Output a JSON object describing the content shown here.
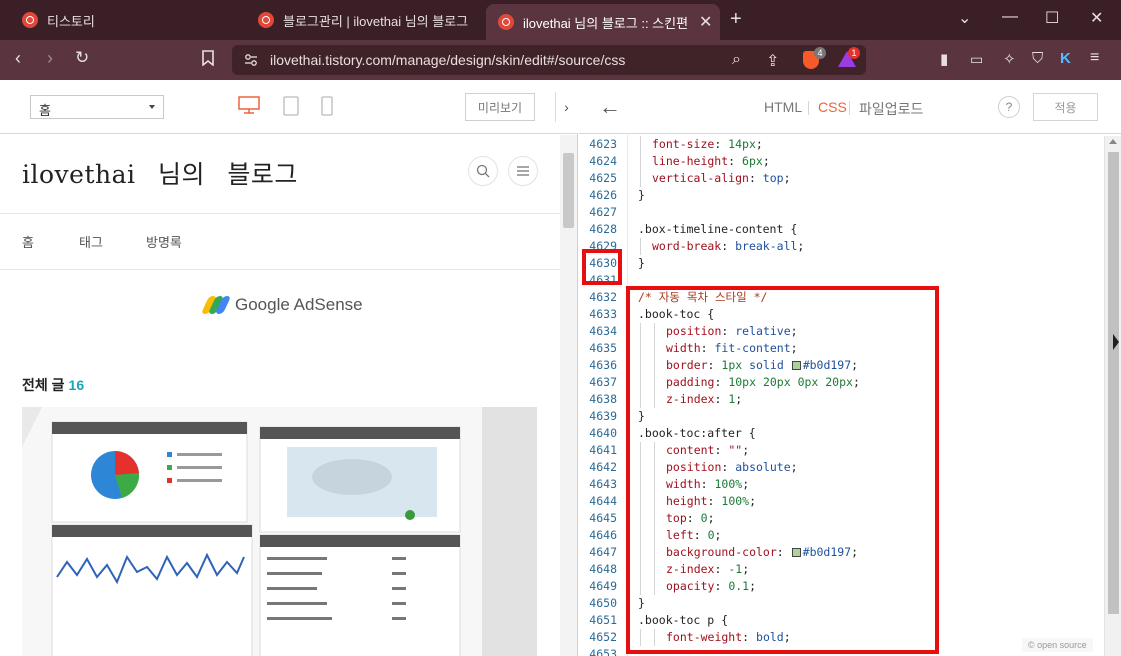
{
  "browser": {
    "tabs": [
      {
        "label": "티스토리",
        "active": false
      },
      {
        "label": "블로그관리 | ilovethai 님의 블로그",
        "active": false
      },
      {
        "label": "ilovethai 님의 블로그 :: 스킨편",
        "active": true
      }
    ],
    "url": "ilovethai.tistory.com/manage/design/skin/edit#/source/css",
    "badges": {
      "brave": "4",
      "rewards": "1"
    }
  },
  "preview": {
    "page_select": "홈",
    "preview_button": "미리보기",
    "blog_title": "ilovethai 님의 블로그",
    "menu": [
      "홈",
      "태그",
      "방명록"
    ],
    "adsense_text": "Google AdSense",
    "all_posts_label": "전체 글",
    "all_posts_count": "16"
  },
  "editor": {
    "tabs": [
      {
        "label": "HTML",
        "active": false
      },
      {
        "label": "CSS",
        "active": true
      },
      {
        "label": "파일업로드",
        "active": false
      }
    ],
    "help": "?",
    "apply_button": "적용",
    "open_source": "© open source"
  },
  "code_lines": [
    {
      "n": "4623",
      "indent": 1,
      "tokens": [
        [
          "prop",
          "font-size"
        ],
        [
          "pun",
          ": "
        ],
        [
          "num",
          "14px"
        ],
        [
          "pun",
          ";"
        ]
      ]
    },
    {
      "n": "4624",
      "indent": 1,
      "tokens": [
        [
          "prop",
          "line-height"
        ],
        [
          "pun",
          ": "
        ],
        [
          "num",
          "6px"
        ],
        [
          "pun",
          ";"
        ]
      ]
    },
    {
      "n": "4625",
      "indent": 1,
      "tokens": [
        [
          "prop",
          "vertical-align"
        ],
        [
          "pun",
          ": "
        ],
        [
          "val",
          "top"
        ],
        [
          "pun",
          ";"
        ]
      ]
    },
    {
      "n": "4626",
      "indent": 0,
      "tokens": [
        [
          "pun",
          "}"
        ]
      ]
    },
    {
      "n": "4627",
      "indent": 0,
      "tokens": []
    },
    {
      "n": "4628",
      "indent": 0,
      "tokens": [
        [
          "sel",
          ".box-timeline-content "
        ],
        [
          "pun",
          "{"
        ]
      ]
    },
    {
      "n": "4629",
      "indent": 1,
      "tokens": [
        [
          "prop",
          "word-break"
        ],
        [
          "pun",
          ": "
        ],
        [
          "val",
          "break-all"
        ],
        [
          "pun",
          ";"
        ]
      ]
    },
    {
      "n": "4630",
      "indent": 0,
      "tokens": [
        [
          "pun",
          "}"
        ]
      ]
    },
    {
      "n": "4631",
      "indent": 0,
      "tokens": []
    },
    {
      "n": "4632",
      "indent": 0,
      "tokens": [
        [
          "cmt",
          "/* 자동 목차 스타일 */"
        ]
      ]
    },
    {
      "n": "4633",
      "indent": 0,
      "tokens": [
        [
          "sel",
          ".book-toc "
        ],
        [
          "pun",
          "{"
        ]
      ]
    },
    {
      "n": "4634",
      "indent": 2,
      "tokens": [
        [
          "prop",
          "position"
        ],
        [
          "pun",
          ": "
        ],
        [
          "val",
          "relative"
        ],
        [
          "pun",
          ";"
        ]
      ]
    },
    {
      "n": "4635",
      "indent": 2,
      "tokens": [
        [
          "prop",
          "width"
        ],
        [
          "pun",
          ": "
        ],
        [
          "val",
          "fit-content"
        ],
        [
          "pun",
          ";"
        ]
      ]
    },
    {
      "n": "4636",
      "indent": 2,
      "tokens": [
        [
          "prop",
          "border"
        ],
        [
          "pun",
          ": "
        ],
        [
          "num",
          "1px"
        ],
        [
          "pun",
          " "
        ],
        [
          "val",
          "solid"
        ],
        [
          "pun",
          " "
        ],
        [
          "swatch",
          ""
        ],
        [
          "val",
          "#b0d197"
        ],
        [
          "pun",
          ";"
        ]
      ]
    },
    {
      "n": "4637",
      "indent": 2,
      "tokens": [
        [
          "prop",
          "padding"
        ],
        [
          "pun",
          ": "
        ],
        [
          "num",
          "10px 20px 0px 20px"
        ],
        [
          "pun",
          ";"
        ]
      ]
    },
    {
      "n": "4638",
      "indent": 2,
      "tokens": [
        [
          "prop",
          "z-index"
        ],
        [
          "pun",
          ": "
        ],
        [
          "num",
          "1"
        ],
        [
          "pun",
          ";"
        ]
      ]
    },
    {
      "n": "4639",
      "indent": 0,
      "tokens": [
        [
          "pun",
          "}"
        ]
      ]
    },
    {
      "n": "4640",
      "indent": 0,
      "tokens": [
        [
          "sel",
          ".book-toc:after "
        ],
        [
          "pun",
          "{"
        ]
      ]
    },
    {
      "n": "4641",
      "indent": 2,
      "tokens": [
        [
          "prop",
          "content"
        ],
        [
          "pun",
          ": "
        ],
        [
          "str",
          "\"\""
        ],
        [
          "pun",
          ";"
        ]
      ]
    },
    {
      "n": "4642",
      "indent": 2,
      "tokens": [
        [
          "prop",
          "position"
        ],
        [
          "pun",
          ": "
        ],
        [
          "val",
          "absolute"
        ],
        [
          "pun",
          ";"
        ]
      ]
    },
    {
      "n": "4643",
      "indent": 2,
      "tokens": [
        [
          "prop",
          "width"
        ],
        [
          "pun",
          ": "
        ],
        [
          "num",
          "100%"
        ],
        [
          "pun",
          ";"
        ]
      ]
    },
    {
      "n": "4644",
      "indent": 2,
      "tokens": [
        [
          "prop",
          "height"
        ],
        [
          "pun",
          ": "
        ],
        [
          "num",
          "100%"
        ],
        [
          "pun",
          ";"
        ]
      ]
    },
    {
      "n": "4645",
      "indent": 2,
      "tokens": [
        [
          "prop",
          "top"
        ],
        [
          "pun",
          ": "
        ],
        [
          "num",
          "0"
        ],
        [
          "pun",
          ";"
        ]
      ]
    },
    {
      "n": "4646",
      "indent": 2,
      "tokens": [
        [
          "prop",
          "left"
        ],
        [
          "pun",
          ": "
        ],
        [
          "num",
          "0"
        ],
        [
          "pun",
          ";"
        ]
      ]
    },
    {
      "n": "4647",
      "indent": 2,
      "tokens": [
        [
          "prop",
          "background-color"
        ],
        [
          "pun",
          ": "
        ],
        [
          "swatch",
          ""
        ],
        [
          "val",
          "#b0d197"
        ],
        [
          "pun",
          ";"
        ]
      ]
    },
    {
      "n": "4648",
      "indent": 2,
      "tokens": [
        [
          "prop",
          "z-index"
        ],
        [
          "pun",
          ": "
        ],
        [
          "num",
          "-1"
        ],
        [
          "pun",
          ";"
        ]
      ]
    },
    {
      "n": "4649",
      "indent": 2,
      "tokens": [
        [
          "prop",
          "opacity"
        ],
        [
          "pun",
          ": "
        ],
        [
          "num",
          "0.1"
        ],
        [
          "pun",
          ";"
        ]
      ]
    },
    {
      "n": "4650",
      "indent": 0,
      "tokens": [
        [
          "pun",
          "}"
        ]
      ]
    },
    {
      "n": "4651",
      "indent": 0,
      "tokens": [
        [
          "sel",
          ".book-toc p "
        ],
        [
          "pun",
          "{"
        ]
      ]
    },
    {
      "n": "4652",
      "indent": 2,
      "tokens": [
        [
          "prop",
          "font-weight"
        ],
        [
          "pun",
          ": "
        ],
        [
          "val",
          "bold"
        ],
        [
          "pun",
          ";"
        ]
      ]
    },
    {
      "n": "4653",
      "indent": 0,
      "tokens": []
    }
  ],
  "colors": {
    "accent": "#f0623a",
    "highlight": "#e60e0e",
    "swatch": "#b0d197",
    "count": "#1aa5b8"
  }
}
